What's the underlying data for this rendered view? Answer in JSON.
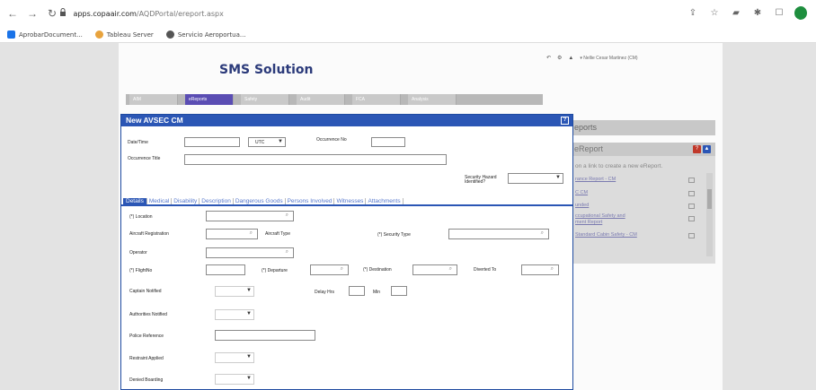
{
  "browser": {
    "host": "apps.copaair.com",
    "path": "/AQDPortal/ereport.aspx",
    "bookmarks": [
      "AprobarDocument...",
      "Tableau Server",
      "Servicio Aeroportua..."
    ]
  },
  "app": {
    "logo": "SMS Solution",
    "user": "Nellie Cesar Martinez (CM)",
    "tabs": [
      "AIM",
      "eReports",
      "Safety",
      "Audit",
      "FCA",
      "Analysis"
    ]
  },
  "reports_panel": {
    "header": "eports",
    "sub_header": "eReport",
    "hint": "on a link to create a new eReport.",
    "links": [
      "rance Report - CM",
      "C CM",
      "unded",
      "ccupational Safety and",
      "ment Report",
      "Standard Cabin Safety - CM"
    ]
  },
  "modal": {
    "title": "New AVSEC CM",
    "help": "?",
    "date_time_label": "Date/Time",
    "timezone_value": "UTC",
    "occurrence_no_label": "Occurrence No",
    "occurrence_title_label": "Occurrence Title",
    "security_hazard_label": "Security Hazard Identified?",
    "tabs": [
      "Details",
      "Medical",
      "Disability",
      "Description",
      "Dangerous Goods",
      "Persons Involved",
      "Witnesses",
      "Attachments"
    ],
    "fields": {
      "location": "(*) Location",
      "aircraft_registration": "Aircraft Registration",
      "aircraft_type": "Aircraft Type",
      "security_type": "(*) Security Type",
      "operator": "Operator",
      "flight_no": "(*) FlightNo",
      "departure": "(*) Departure",
      "destination": "(*) Destination",
      "diverted_to": "Diverted To",
      "captain_notified": "Captain Notified",
      "delay_hrs": "Delay Hrs",
      "min": "Min",
      "authorities_notified": "Authorities Notified",
      "police_reference": "Police Reference",
      "restraint_applied": "Restraint Applied",
      "denied_boarding": "Denied Boarding"
    }
  },
  "colors": {
    "modal_blue": "#2b56b5",
    "active_tab": "#5a4db3",
    "profile_green": "#1e8e3e",
    "help_red": "#c0392b"
  }
}
